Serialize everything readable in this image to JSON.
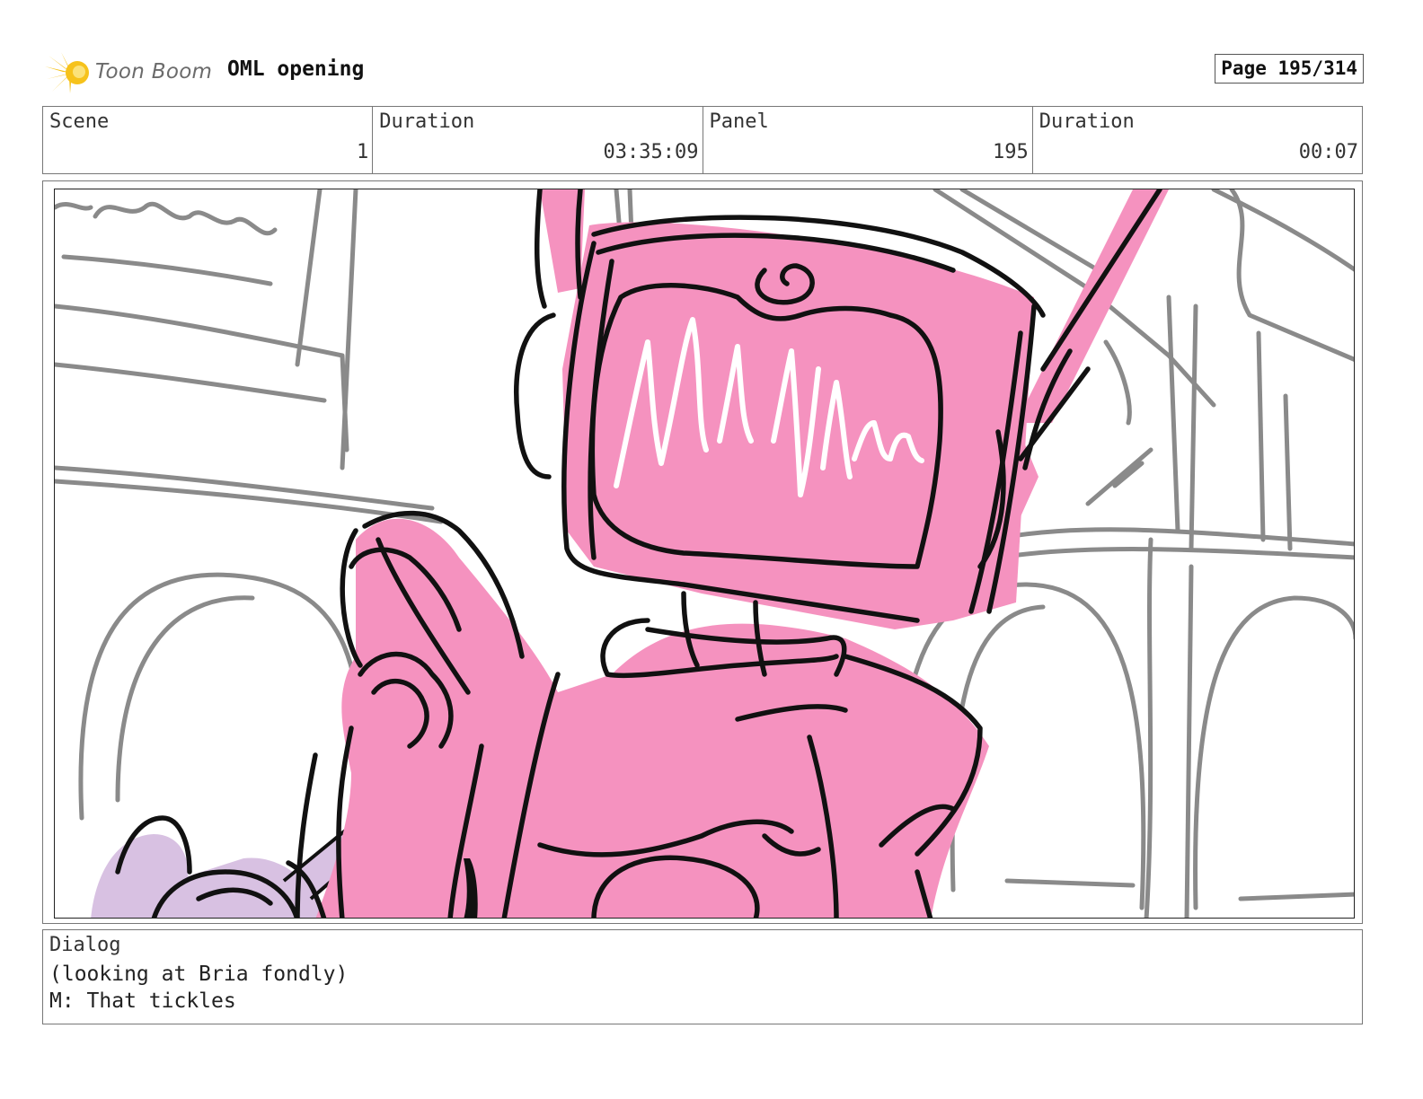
{
  "header": {
    "logo_text": "Toon Boom",
    "project_title": "OML opening",
    "page_label": "Page 195/314"
  },
  "info": {
    "scene_label": "Scene",
    "scene_value": "1",
    "scene_duration_label": "Duration",
    "scene_duration_value": "03:35:09",
    "panel_label": "Panel",
    "panel_value": "195",
    "panel_duration_label": "Duration",
    "panel_duration_value": "00:07"
  },
  "dialog": {
    "label": "Dialog",
    "lines": [
      "(looking at Bria fondly)",
      "M: That tickles"
    ]
  },
  "colors": {
    "robot_pink": "#f592bf",
    "tool_lavender": "#d8c1e2",
    "background_gray": "#8a8a8a",
    "ink": "#111111",
    "logo_yellow": "#f6c21b"
  }
}
